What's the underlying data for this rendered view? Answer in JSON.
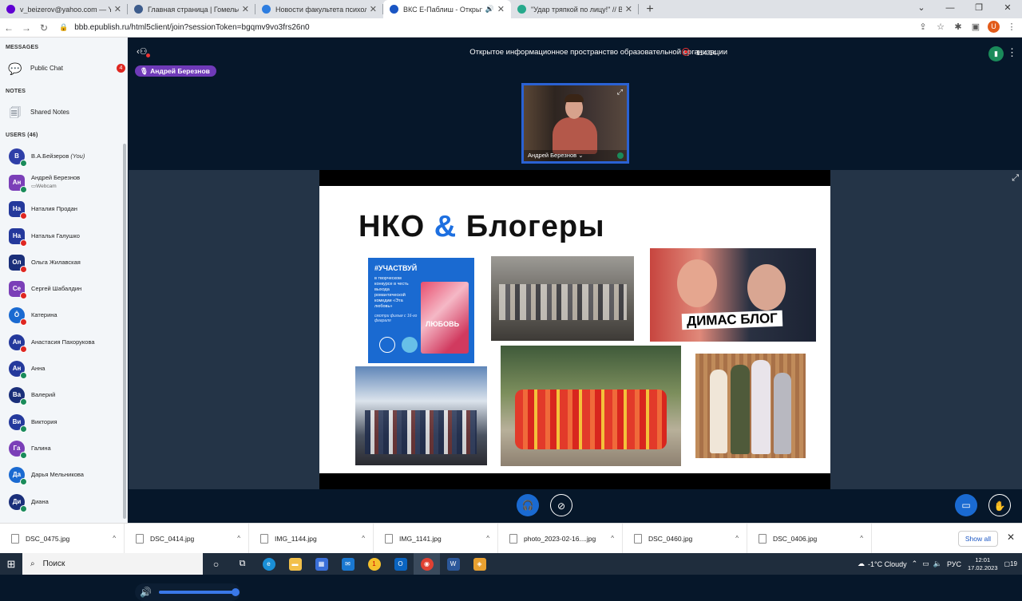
{
  "browser": {
    "tabs": [
      {
        "title": "v_beizerov@yahoo.com — Yaho",
        "color": "#6001d2",
        "active": false
      },
      {
        "title": "Главная страница | Гомельский",
        "color": "#3d5c8c",
        "active": false
      },
      {
        "title": "Новости факультета психологи",
        "color": "#2d7de0",
        "active": false
      },
      {
        "title": "ВКС Е-Паблиш - Открытое",
        "color": "#1a56c4",
        "active": true
      },
      {
        "title": "\"Удар тряпкой по лицу!\" // ВОС",
        "color": "#27a98c",
        "active": false
      }
    ],
    "url": "bbb.epublish.ru/html5client/join?sessionToken=bgqmv9vo3frs26n0",
    "profile_initial": "U"
  },
  "sidebar": {
    "messages_header": "MESSAGES",
    "public_chat_label": "Public Chat",
    "public_chat_badge": "4",
    "notes_header": "NOTES",
    "shared_notes_label": "Shared Notes",
    "users_header": "USERS (46)",
    "users": [
      {
        "initials": "B",
        "name": "В.А.Бейзеров",
        "suffix": "(You)",
        "color": "#2f3fa8",
        "status": "#1a8b5a",
        "round": true,
        "sub": ""
      },
      {
        "initials": "Ан",
        "name": "Андрей Березнов",
        "suffix": "",
        "color": "#7b3fb8",
        "status": "#1a8b5a",
        "round": false,
        "sub": "Webcam"
      },
      {
        "initials": "На",
        "name": "Наталия Продан",
        "suffix": "",
        "color": "#24399c",
        "status": "#df2721",
        "round": false,
        "sub": ""
      },
      {
        "initials": "На",
        "name": "Наталья Галушко",
        "suffix": "",
        "color": "#24399c",
        "status": "#df2721",
        "round": false,
        "sub": ""
      },
      {
        "initials": "Ол",
        "name": "Ольга Жилавская",
        "suffix": "",
        "color": "#1a2f7a",
        "status": "#df2721",
        "round": false,
        "sub": ""
      },
      {
        "initials": "Се",
        "name": "Сергей Шабалдин",
        "suffix": "",
        "color": "#7b3fb8",
        "status": "#df2721",
        "round": false,
        "sub": ""
      },
      {
        "initials": "Ô",
        "name": "Катерина",
        "suffix": "",
        "color": "#1a6ad1",
        "status": "#df2721",
        "round": true,
        "sub": ""
      },
      {
        "initials": "Ан",
        "name": "Анастасия Пахорукова",
        "suffix": "",
        "color": "#24399c",
        "status": "#df2721",
        "round": true,
        "sub": ""
      },
      {
        "initials": "Ан",
        "name": "Анна",
        "suffix": "",
        "color": "#24399c",
        "status": "#1a8b5a",
        "round": true,
        "sub": ""
      },
      {
        "initials": "Ва",
        "name": "Валерий",
        "suffix": "",
        "color": "#1a2f7a",
        "status": "#1a8b5a",
        "round": true,
        "sub": ""
      },
      {
        "initials": "Ви",
        "name": "Виктория",
        "suffix": "",
        "color": "#24399c",
        "status": "#1a8b5a",
        "round": true,
        "sub": ""
      },
      {
        "initials": "Га",
        "name": "Галина",
        "suffix": "",
        "color": "#7b3fb8",
        "status": "#1a8b5a",
        "round": true,
        "sub": ""
      },
      {
        "initials": "Да",
        "name": "Дарья Мельникова",
        "suffix": "",
        "color": "#1a6ad1",
        "status": "#1a8b5a",
        "round": true,
        "sub": ""
      },
      {
        "initials": "Ди",
        "name": "Диана",
        "suffix": "",
        "color": "#1a2f7a",
        "status": "#1a8b5a",
        "round": true,
        "sub": ""
      }
    ]
  },
  "meeting": {
    "title": "Открытое информационное пространство образовательной организации",
    "timer": "114:14",
    "talking_user": "Андрей Березнов",
    "webcam_name": "Андрей Березнов"
  },
  "slide": {
    "title_a": "НКО",
    "title_amp": "&",
    "title_b": "Блогеры",
    "poster_tag": "#УЧАСТВУЙ",
    "poster_text": "в творческом конкурсе в честь выхода романтической комедии «Эта любовь»",
    "poster_small": "смотри фильм с 16-го февраля",
    "poster_word": "ЛЮБОВЬ",
    "blog_caption": "ДИМАС БЛОГ"
  },
  "downloads": {
    "files": [
      "DSC_0475.jpg",
      "DSC_0414.jpg",
      "IMG_1144.jpg",
      "IMG_1141.jpg",
      "photo_2023-02-16....jpg",
      "DSC_0460.jpg",
      "DSC_0406.jpg"
    ],
    "show_all": "Show all"
  },
  "taskbar": {
    "search_label": "Поиск",
    "weather": "-1°C  Cloudy",
    "lang": "РУС",
    "time": "12:01",
    "date": "17.02.2023",
    "notif_count": "19"
  }
}
